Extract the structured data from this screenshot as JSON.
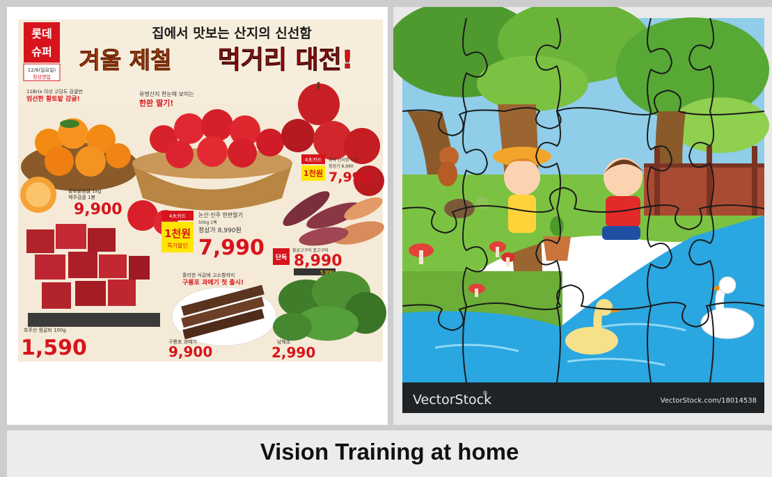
{
  "caption": "Vision Training at home",
  "flyer": {
    "logo_line1": "롯데",
    "logo_line2": "슈퍼",
    "date_badge": "12/6(일요일)",
    "date_sub": "정상영업",
    "headline_top": "집에서 맛보는 산지의 신선함",
    "headline_main_a": "겨울 제철",
    "headline_main_b": "먹거리 대전!",
    "tangerine_note_1": "11Brix 이상 고당도 감귤만",
    "tangerine_note_2": "엄선한 황토밭 감귤!",
    "tangerine_label": "황토밭감귤 1kg",
    "tangerine_label_2": "제주감귤 1봉",
    "tangerine_price": "9,900",
    "strawberry_note_1": "유명산지 한눈에 보이는",
    "strawberry_note_2": "한판 딸기!",
    "strawberry_card": "4大카드",
    "strawberry_badge": "1천원",
    "strawberry_badge_2": "특가할인",
    "strawberry_label": "논산·진주 한판딸기",
    "strawberry_label_2": "500g 1팩",
    "strawberry_normal": "정상가 8,990원",
    "strawberry_price": "7,990",
    "apple_card": "4大카드",
    "apple_badge": "1천원",
    "apple_label": "경북 산지명 사과",
    "apple_normal": "정상가 8,990",
    "apple_price": "7,990",
    "potato_label": "황금고구마 꿀고구마",
    "potato_badge": "단독",
    "potato_price": "8,990",
    "potato_card": "5,990",
    "beef_label": "호주산 찜갈비 100g",
    "beef_price": "1,590",
    "fish_note_1": "홀리한 식감에 고소함까지",
    "fish_note_2": "구룡포 과메기 첫 출시!",
    "fish_label": "구룡포 과메기",
    "fish_price": "9,900",
    "greens_label": "남해초",
    "greens_price": "2,990",
    "won": "원"
  },
  "puzzle": {
    "brand": "VectorStock",
    "brand_mark": "®",
    "url": "VectorStock.com/18014538"
  },
  "colors": {
    "flyer_red": "#d7141c",
    "puzzle_footer": "#1f2326",
    "sky": "#8fcde9",
    "grass": "#7cc242",
    "water": "#2aa6e0"
  }
}
